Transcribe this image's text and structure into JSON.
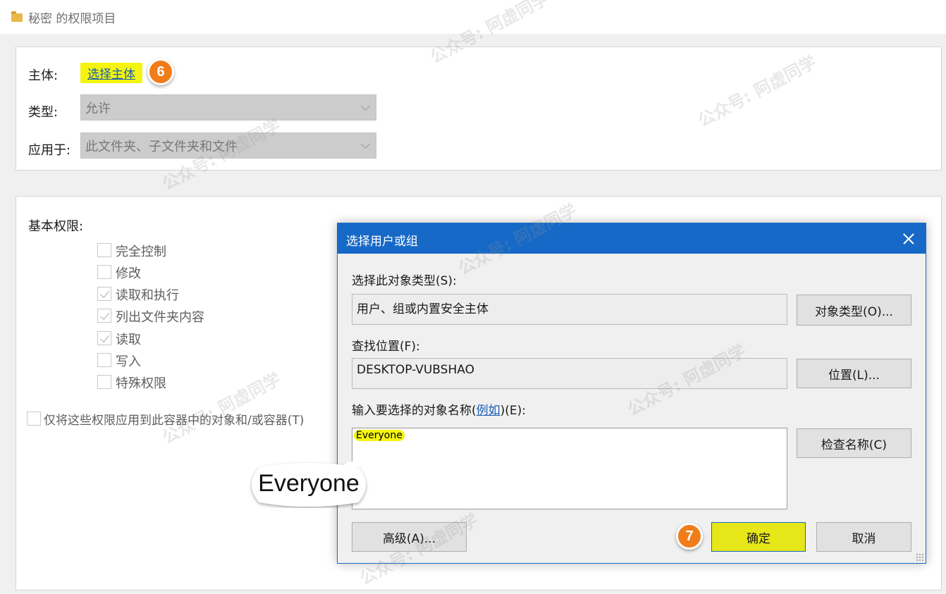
{
  "window": {
    "title": "秘密 的权限项目"
  },
  "principal": {
    "label": "主体:",
    "link": "选择主体",
    "step": "6"
  },
  "type": {
    "label": "类型:",
    "value": "允许"
  },
  "applies_to": {
    "label": "应用于:",
    "value": "此文件夹、子文件夹和文件"
  },
  "permissions": {
    "heading": "基本权限:",
    "items": [
      {
        "label": "完全控制",
        "checked": false
      },
      {
        "label": "修改",
        "checked": false
      },
      {
        "label": "读取和执行",
        "checked": true
      },
      {
        "label": "列出文件夹内容",
        "checked": true
      },
      {
        "label": "读取",
        "checked": true
      },
      {
        "label": "写入",
        "checked": false
      },
      {
        "label": "特殊权限",
        "checked": false
      }
    ],
    "apply_only": "仅将这些权限应用到此容器中的对象和/或容器(T)"
  },
  "dialog": {
    "title": "选择用户或组",
    "object_type_label": "选择此对象类型(S):",
    "object_type_value": "用户、组或内置安全主体",
    "object_type_button": "对象类型(O)...",
    "location_label": "查找位置(F):",
    "location_value": "DESKTOP-VUBSHAO",
    "location_button": "位置(L)...",
    "names_label_pre": "输入要选择的对象名称(",
    "names_label_link": "例如",
    "names_label_post": ")(E):",
    "names_value": "Everyone",
    "check_names_button": "检查名称(C)",
    "advanced_button": "高级(A)...",
    "ok_button": "确定",
    "cancel_button": "取消",
    "step": "7"
  },
  "callout": {
    "text": "Everyone"
  },
  "watermark": "公众号: 阿虚同学",
  "colors": {
    "highlight": "#f4f40f",
    "badge": "#f07d1a",
    "dialog_title": "#1769c7",
    "link": "#1a5fb4"
  }
}
